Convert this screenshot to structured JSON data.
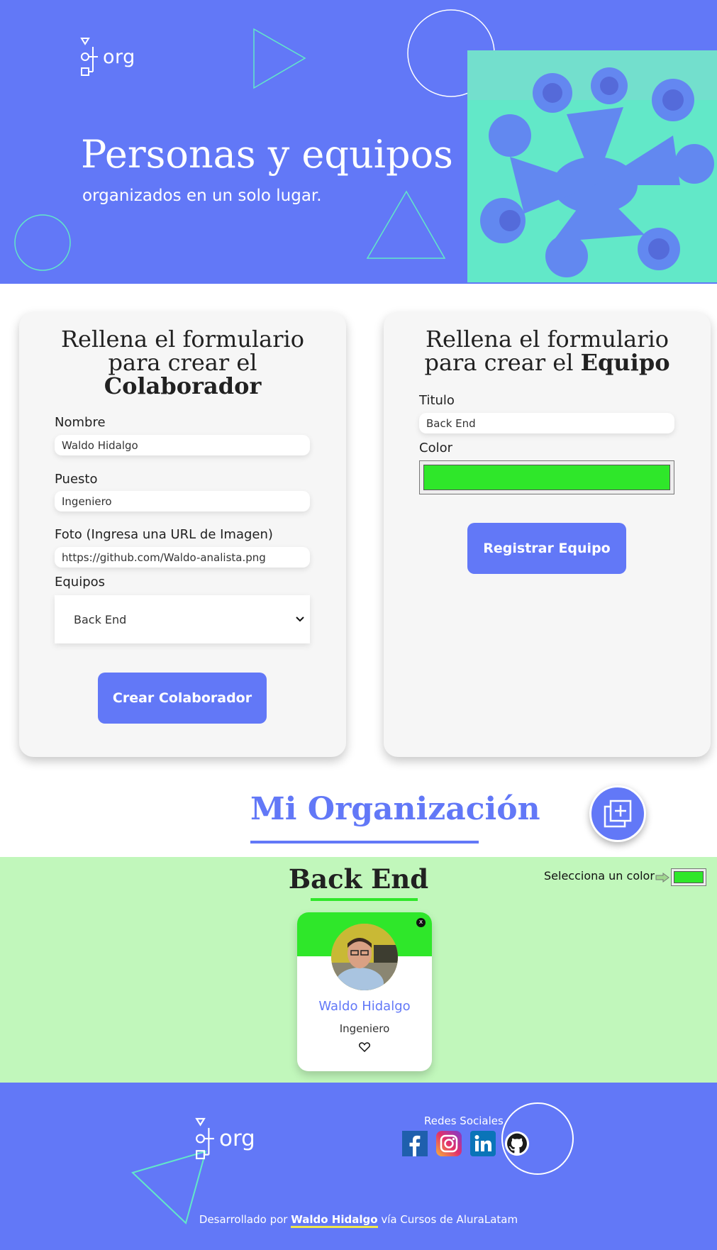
{
  "colors": {
    "primary": "#6278f7",
    "hero_accent": "#62e8c8",
    "team_bg": "#c1f7bb",
    "team_color": "#2fe72a",
    "card_bg": "#f6f6f6"
  },
  "header": {
    "logo_text": "org",
    "title": "Personas y equipos",
    "subtitle": "organizados en un solo lugar.",
    "hero_image": "team-hands-together-photo"
  },
  "collaborator_form": {
    "heading_line1": "Rellena el formulario",
    "heading_line2": "para crear el",
    "heading_bold": "Colaborador",
    "name_label": "Nombre",
    "name_value": "Waldo Hidalgo",
    "role_label": "Puesto",
    "role_value": "Ingeniero",
    "photo_label": "Foto (Ingresa una URL de Imagen)",
    "photo_value": "https://github.com/Waldo-analista.png",
    "team_label": "Equipos",
    "team_selected": "Back End",
    "submit_label": "Crear Colaborador"
  },
  "team_form": {
    "heading_line1": "Rellena el formulario",
    "heading_line2": "para crear el",
    "heading_bold": "Equipo",
    "title_label": "Titulo",
    "title_value": "Back End",
    "color_label": "Color",
    "color_value": "#2fe72a",
    "submit_label": "Registrar Equipo"
  },
  "organization": {
    "title": "Mi Organización",
    "toggle_icon": "add-square-icon"
  },
  "team": {
    "title": "Back End",
    "color_picker_label": "Selecciona un color",
    "color": "#2fe72a",
    "members": [
      {
        "name": "Waldo Hidalgo",
        "role": "Ingeniero",
        "favorite_icon": "heart-outline-icon"
      }
    ]
  },
  "footer": {
    "logo_text": "org",
    "social_title": "Redes Sociales",
    "socials": [
      "facebook-icon",
      "instagram-icon",
      "linkedin-icon",
      "github-icon"
    ],
    "credit_prefix": "Desarrollado por",
    "credit_author": "Waldo Hidalgo",
    "credit_suffix": "vía Cursos de AluraLatam"
  }
}
